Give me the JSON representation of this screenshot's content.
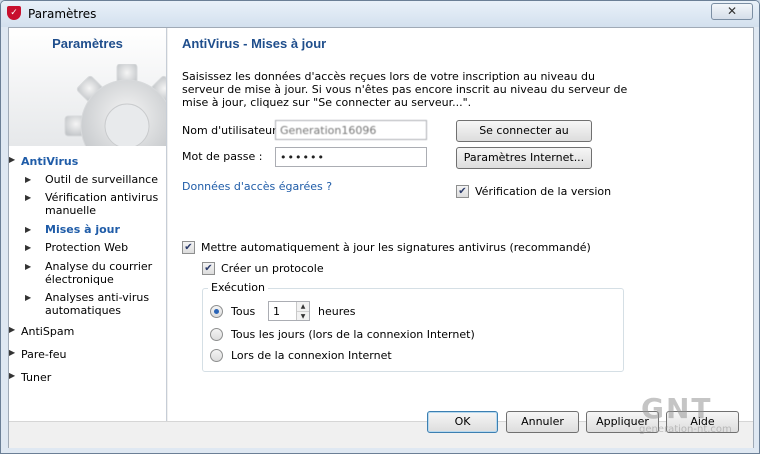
{
  "window": {
    "title": "Paramètres",
    "close_glyph": "✕"
  },
  "sidebar": {
    "title": "Paramètres",
    "items": [
      {
        "label": "AntiVirus",
        "expanded": true
      },
      {
        "label": "AntiSpam"
      },
      {
        "label": "Pare-feu"
      },
      {
        "label": "Tuner"
      }
    ],
    "sub_items": [
      {
        "label": "Outil de surveillance"
      },
      {
        "label": "Vérification antivirus manuelle"
      },
      {
        "label": "Mises à jour",
        "active": true
      },
      {
        "label": "Protection Web"
      },
      {
        "label": "Analyse du courrier électronique"
      },
      {
        "label": "Analyses anti-virus automatiques"
      }
    ]
  },
  "content": {
    "title": "AntiVirus - Mises à jour",
    "description": "Saisissez les données d'accès reçues lors de votre inscription au niveau du serveur de mise à jour. Si vous n'êtes pas encore inscrit au niveau du serveur de mise à jour, cliquez sur \"Se connecter au serveur...\".",
    "username_label": "Nom d'utilisateur :",
    "username_value": "Generation16096",
    "password_label": "Mot de passe :",
    "password_value": "••••••",
    "connect_button": "Se connecter au serveur...",
    "internet_button": "Paramètres Internet...",
    "lost_link": "Données d'accès égarées ?",
    "version_check": "Vérification de la version",
    "auto_update": "Mettre automatiquement à jour les signatures antivirus (recommandé)",
    "create_log": "Créer un protocole",
    "execution_legend": "Exécution",
    "every_label": "Tous",
    "every_value": "1",
    "hours_label": "heures",
    "daily_label": "Tous les jours (lors de la connexion Internet)",
    "on_connect_label": "Lors de la connexion Internet"
  },
  "footer": {
    "ok": "OK",
    "cancel": "Annuler",
    "apply": "Appliquer",
    "help": "Aide"
  },
  "watermark": {
    "logo": "GNT",
    "site": "generation-nt.com"
  },
  "colors": {
    "accent_title": "#1f4e8c",
    "link": "#1f5ca8",
    "check": "#2b3b6b"
  }
}
